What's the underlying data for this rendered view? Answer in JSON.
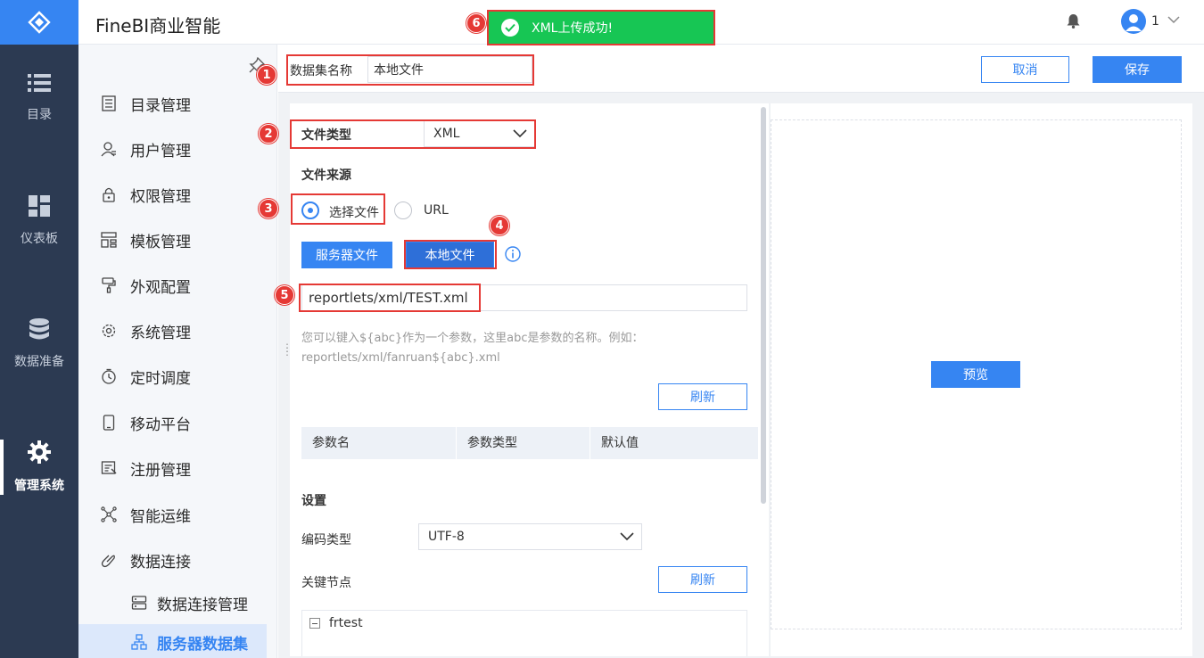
{
  "app": {
    "title": "FineBI商业智能",
    "user_name": "1"
  },
  "rail": {
    "items": [
      {
        "label": "目录",
        "icon": "list-icon"
      },
      {
        "label": "仪表板",
        "icon": "dashboard-icon"
      },
      {
        "label": "数据准备",
        "icon": "database-icon"
      },
      {
        "label": "管理系统",
        "icon": "gear-icon",
        "active": true
      }
    ]
  },
  "sidebar": {
    "items": [
      {
        "label": "目录管理",
        "icon": "catalog-icon"
      },
      {
        "label": "用户管理",
        "icon": "user-icon"
      },
      {
        "label": "权限管理",
        "icon": "lock-icon"
      },
      {
        "label": "模板管理",
        "icon": "template-icon"
      },
      {
        "label": "外观配置",
        "icon": "brush-icon"
      },
      {
        "label": "系统管理",
        "icon": "settings-icon"
      },
      {
        "label": "定时调度",
        "icon": "timer-icon"
      },
      {
        "label": "移动平台",
        "icon": "mobile-icon"
      },
      {
        "label": "注册管理",
        "icon": "register-icon"
      },
      {
        "label": "智能运维",
        "icon": "ops-icon"
      },
      {
        "label": "数据连接",
        "icon": "link-icon"
      }
    ],
    "sub_items": [
      {
        "label": "数据连接管理",
        "icon": "server-icon"
      },
      {
        "label": "服务器数据集",
        "icon": "dataset-icon",
        "selected": true
      }
    ]
  },
  "toolbar": {
    "dataset_name_label": "数据集名称",
    "dataset_name_value": "本地文件",
    "cancel_label": "取消",
    "save_label": "保存"
  },
  "form": {
    "file_type_label": "文件类型",
    "file_type_value": "XML",
    "file_source_label": "文件来源",
    "radio_choose_file": "选择文件",
    "radio_url": "URL",
    "server_file_button": "服务器文件",
    "local_file_button": "本地文件",
    "path_value": "reportlets/xml/TEST.xml",
    "hint_line1": "您可以键入${abc}作为一个参数，这里abc是参数的名称。例如：",
    "hint_line2": "reportlets/xml/fanruan${abc}.xml",
    "refresh_label": "刷新",
    "param_columns": [
      "参数名",
      "参数类型",
      "默认值"
    ],
    "settings_label": "设置",
    "encoding_label": "编码类型",
    "encoding_value": "UTF-8",
    "key_node_label": "关键节点",
    "refresh2_label": "刷新",
    "tree_node": "frtest"
  },
  "preview": {
    "button_label": "预览"
  },
  "toast": {
    "message": "XML上传成功!"
  },
  "annotations": [
    "1",
    "2",
    "3",
    "4",
    "5",
    "6"
  ],
  "colors": {
    "accent": "#3685f2",
    "rail_bg": "#2c3a52",
    "annotation_red": "#e53935",
    "toast_green": "#17c654"
  }
}
